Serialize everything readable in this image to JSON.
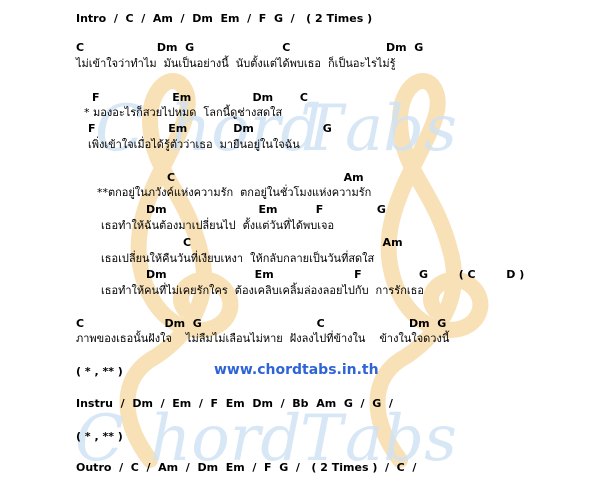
{
  "watermark": {
    "brand": "chord tabs",
    "colors": {
      "note": "#f7dcaa",
      "text": "#cfe2f5"
    }
  },
  "sheet": {
    "intro": "Intro  /  C  /  Am  /  Dm  Em  /  F  G  /   ( 2 Times )",
    "v1_chords": "C                   Dm  G                       C                         Dm  G",
    "v1_lyrics": "ไม่เข้าใจว่าทำไม  มันเป็นอย่างนี้  นับตั้งแต่ได้พบเธอ  ก็เป็นอะไรไม่รู้",
    "v2_chords": "F                   Em                Dm       C",
    "v2_lyrics": "* มองอะไรก็สวยไปหมด  โลกนี้ดูช่างสดใส",
    "v3_chords": "F                   Em            Dm                  G",
    "v3_lyrics": "เพิ่งเข้าใจเมื่อได้รู้ตัวว่าเธอ  มายืนอยู่ในใจฉัน",
    "c1_chords": "C                                            Am",
    "c1_lyrics": "**ตกอยู่ในภวังค์แห่งความรัก  ตกอยู่ในชั่วโมงแห่งความรัก",
    "c2_chords": "Dm                        Em          F              G",
    "c2_lyrics": "เธอทำให้ฉันต้องมาเปลี่ยนไป  ตั้งแต่วันที่ได้พบเจอ",
    "c3_chords": "C                                                  Am",
    "c3_lyrics": "เธอเปลี่ยนให้คืนวันที่เงียบเหงา  ให้กลับกลายเป็นวันที่สดใส",
    "c4_chords": "Dm                       Em                     F               G        ( C        D )",
    "c4_lyrics": "เธอทำให้คนที่ไม่เคยรักใคร  ต้องเคลิบเคลิ้มล่องลอยไปกับ  การรักเธอ",
    "e_chords": "C                     Dm  G                              C                      Dm  G",
    "e_lyrics": "ภาพของเธอนั้นฝังใจ    ไม่ลืมไม่เลือนไม่หาย  ฝังลงไปที่ข้างใน    ข้างในใจดวงนี้",
    "repeat1": "( * , ** )",
    "website": "www.chordtabs.in.th",
    "instru": "Instru  /  Dm  /  Em  /  F  Em  Dm  /  Bb  Am  G  /  G  /",
    "repeat2": "( * , ** )",
    "outro": "Outro  /  C  /  Am  /  Dm  Em  /  F  G  /   ( 2 Times )  /  C  /"
  }
}
